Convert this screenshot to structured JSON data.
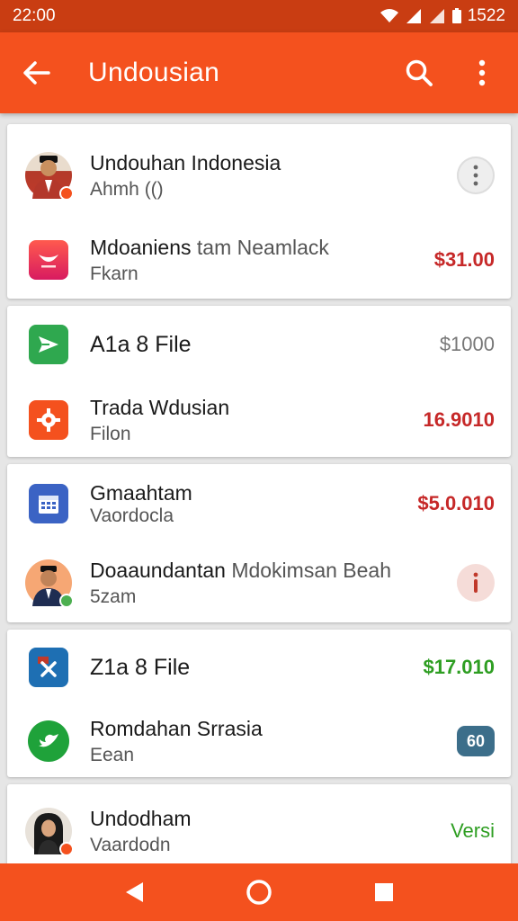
{
  "status": {
    "time": "22:00",
    "battery_label": "1522"
  },
  "header": {
    "title": "Undousian"
  },
  "colors": {
    "accent": "#f4511e",
    "status_bar": "#c93d12",
    "red_amount": "#c62828",
    "green_amount": "#2e9e22"
  },
  "cards": [
    {
      "rows": [
        {
          "primary": "Undouhan Indonesia",
          "secondary": "Ahmh (()",
          "trailing": "more-options-circle"
        },
        {
          "primary": "Mdoaniens",
          "primary_light": "tam Neamlack",
          "secondary": "Fkarn",
          "amount": "$31.00"
        }
      ]
    },
    {
      "rows": [
        {
          "primary": "A1a 8 File",
          "amount": "$1000"
        },
        {
          "primary": "Trada Wdusian",
          "secondary": "Filon",
          "amount": "16.9010"
        }
      ]
    },
    {
      "rows": [
        {
          "primary": "Gmaahtam",
          "secondary": "Vaordocla",
          "amount": "$5.0.010"
        },
        {
          "primary": "Doaaundantan",
          "primary_light": "Mdokimsan Beah",
          "secondary": "5zam",
          "trailing": "info-circle"
        }
      ]
    },
    {
      "rows": [
        {
          "primary": "Z1a 8 File",
          "amount": "$17.010"
        },
        {
          "primary": "Romdahan Srrasia",
          "secondary": "Eean",
          "trailing": "60"
        }
      ]
    },
    {
      "rows": [
        {
          "primary": "Undodham",
          "secondary": "Vaardodn",
          "amount": "Versi"
        }
      ]
    }
  ]
}
